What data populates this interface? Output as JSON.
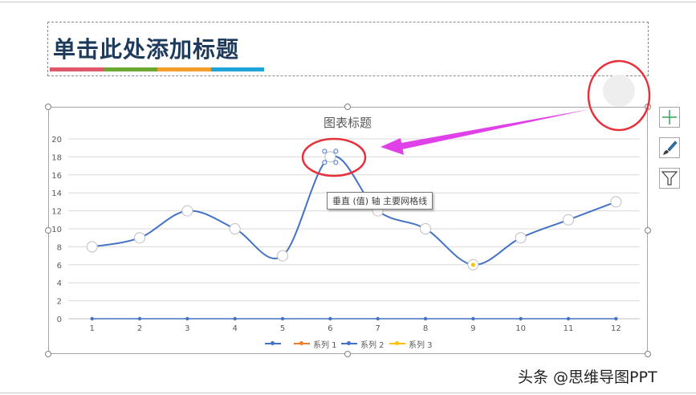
{
  "slide": {
    "title": "单击此处添加标题",
    "title_bar_colors": [
      "#e0566b",
      "#6aa832",
      "#f09e28",
      "#1ea4d8"
    ]
  },
  "chart_data": {
    "type": "line",
    "title": "图表标题",
    "categories": [
      1,
      2,
      3,
      4,
      5,
      6,
      7,
      8,
      9,
      10,
      11,
      12
    ],
    "ylim": [
      0,
      20
    ],
    "yticks": [
      0,
      2,
      4,
      6,
      8,
      10,
      12,
      14,
      16,
      18,
      20
    ],
    "grid": true,
    "legend_position": "bottom",
    "smooth": true,
    "series": [
      {
        "name": "系列 1",
        "values": [
          0,
          0,
          0,
          0,
          0,
          0,
          0,
          0,
          0,
          0,
          0,
          0
        ],
        "color": "#4472c4",
        "legend_color": "#ed7d31"
      },
      {
        "name": "系列 2",
        "values": [
          8,
          9,
          12,
          10,
          7,
          18,
          12,
          10,
          6,
          9,
          11,
          13
        ],
        "color": "#4472c4"
      },
      {
        "name": "系列 3",
        "values": [],
        "color": "#ffc000"
      }
    ],
    "legend_extra_entry_color": "#4472c4"
  },
  "tooltip": {
    "text": "垂直 (值) 轴 主要网格线"
  },
  "side_buttons": [
    "add-chart-element-icon",
    "chart-styles-icon",
    "chart-filter-icon"
  ],
  "annotation_colors": {
    "circle": "#e8303a",
    "arrow": "#e040e8"
  },
  "watermark": "头条 @思维导图PPT"
}
